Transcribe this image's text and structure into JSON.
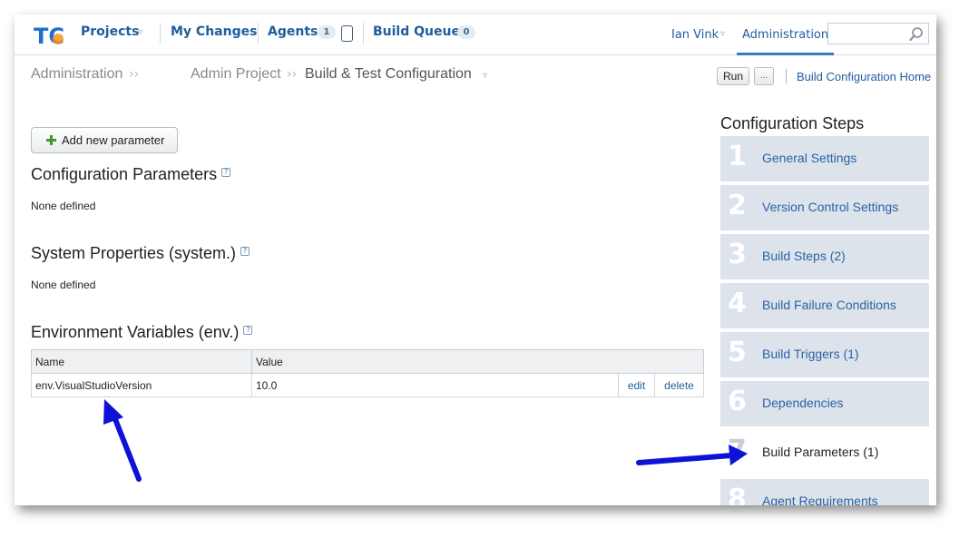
{
  "colors": {
    "link": "#1f5d9c",
    "accent": "#2e7cc4",
    "step_bg": "#dde3ea",
    "arrow": "#0d12d6"
  },
  "logo": {
    "text": "TC"
  },
  "nav": {
    "projects": "Projects",
    "my_changes": "My Changes",
    "agents": "Agents",
    "agents_count": "1",
    "build_queue": "Build Queue",
    "build_queue_count": "0",
    "user": "Ian Vink",
    "administration": "Administration",
    "search_value": ""
  },
  "breadcrumb": {
    "items": [
      "Administration",
      "Admin Project",
      "Build & Test Configuration"
    ],
    "run_label": "Run",
    "run_more": "...",
    "home_link": "Build Configuration Home"
  },
  "main": {
    "add_param_label": "Add new parameter",
    "config_params_title": "Configuration Parameters",
    "config_params_empty": "None defined",
    "system_props_title": "System Properties (system.)",
    "system_props_empty": "None defined",
    "env_vars_title": "Environment Variables (env.)",
    "help": "?",
    "env_table": {
      "headers": [
        "Name",
        "Value"
      ],
      "rows": [
        {
          "name": "env.VisualStudioVersion",
          "value": "10.0",
          "edit": "edit",
          "delete": "delete"
        }
      ]
    }
  },
  "steps": {
    "title": "Configuration Steps",
    "items": [
      {
        "num": "1",
        "label": "General Settings"
      },
      {
        "num": "2",
        "label": "Version Control Settings"
      },
      {
        "num": "3",
        "label": "Build Steps (2)"
      },
      {
        "num": "4",
        "label": "Build Failure Conditions"
      },
      {
        "num": "5",
        "label": "Build Triggers (1)"
      },
      {
        "num": "6",
        "label": "Dependencies"
      },
      {
        "num": "7",
        "label": "Build Parameters (1)"
      },
      {
        "num": "8",
        "label": "Agent Requirements"
      }
    ]
  }
}
